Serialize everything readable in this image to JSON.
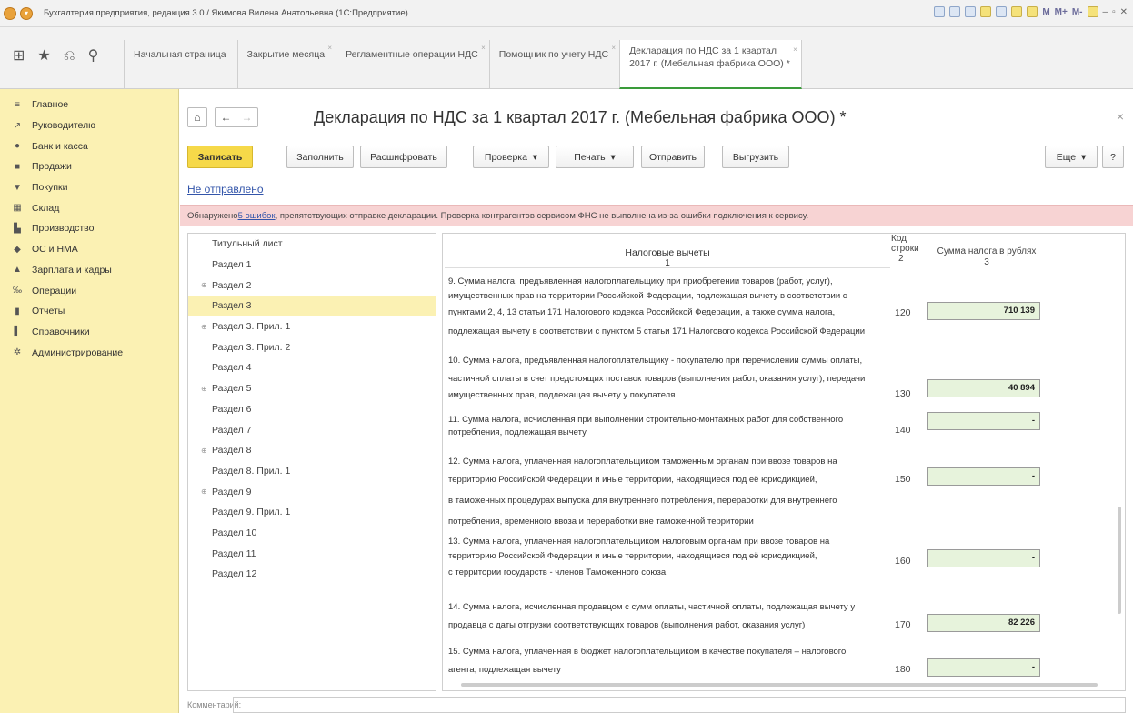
{
  "window": {
    "title": "Бухгалтерия предприятия, редакция 3.0 / Якимова Вилена Анатольевна (1С:Предприятие)",
    "controls": [
      "M",
      "M+",
      "M-"
    ]
  },
  "tabs": [
    {
      "label": "Начальная страница"
    },
    {
      "label": "Закрытие месяца"
    },
    {
      "label": "Регламентные операции НДС"
    },
    {
      "label": "Помощник по учету НДС"
    },
    {
      "label_line1": "Декларация по НДС за 1 квартал",
      "label_line2": "2017 г. (Мебельная фабрика ООО) *"
    }
  ],
  "sidebar": {
    "items": [
      {
        "label": "Главное",
        "icon": "≡"
      },
      {
        "label": "Руководителю",
        "icon": "↗"
      },
      {
        "label": "Банк и касса",
        "icon": "●"
      },
      {
        "label": "Продажи",
        "icon": "■"
      },
      {
        "label": "Покупки",
        "icon": "▼"
      },
      {
        "label": "Склад",
        "icon": "▦"
      },
      {
        "label": "Производство",
        "icon": "▙"
      },
      {
        "label": "ОС и НМА",
        "icon": "◆"
      },
      {
        "label": "Зарплата и кадры",
        "icon": "▲"
      },
      {
        "label": "Операции",
        "icon": "‰"
      },
      {
        "label": "Отчеты",
        "icon": "▮"
      },
      {
        "label": "Справочники",
        "icon": "▌"
      },
      {
        "label": "Администрирование",
        "icon": "✲"
      }
    ]
  },
  "form": {
    "title": "Декларация по НДС за 1 квартал 2017 г. (Мебельная фабрика ООО) *",
    "toolbar": {
      "save": "Записать",
      "fill": "Заполнить",
      "decode": "Расшифровать",
      "check": "Проверка",
      "print": "Печать",
      "send": "Отправить",
      "export": "Выгрузить",
      "more": "Еще",
      "help": "?"
    },
    "status": "Не отправлено",
    "error_prefix": "Обнаружено ",
    "error_link": "5 ошибок",
    "error_suffix": ", препятствующих отправке декларации. Проверка контрагентов сервисом ФНС не выполнена из-за ошибки подключения к сервису.",
    "comment_label": "Комментарий:"
  },
  "sections": [
    {
      "label": "Титульный лист",
      "expandable": false
    },
    {
      "label": "Раздел 1",
      "expandable": false
    },
    {
      "label": "Раздел 2",
      "expandable": true
    },
    {
      "label": "Раздел 3",
      "expandable": false,
      "active": true
    },
    {
      "label": "Раздел 3. Прил. 1",
      "expandable": true
    },
    {
      "label": "Раздел 3. Прил. 2",
      "expandable": false
    },
    {
      "label": "Раздел 4",
      "expandable": false
    },
    {
      "label": "Раздел 5",
      "expandable": true
    },
    {
      "label": "Раздел 6",
      "expandable": false
    },
    {
      "label": "Раздел 7",
      "expandable": false
    },
    {
      "label": "Раздел 8",
      "expandable": true
    },
    {
      "label": "Раздел 8. Прил. 1",
      "expandable": false
    },
    {
      "label": "Раздел 9",
      "expandable": true
    },
    {
      "label": "Раздел 9. Прил. 1",
      "expandable": false
    },
    {
      "label": "Раздел 10",
      "expandable": false
    },
    {
      "label": "Раздел 11",
      "expandable": false
    },
    {
      "label": "Раздел 12",
      "expandable": false
    }
  ],
  "table": {
    "header": {
      "col1_title": "Налоговые вычеты",
      "col1_num": "1",
      "code_title_1": "Код",
      "code_title_2": "строки",
      "code_num": "2",
      "sum_title": "Сумма налога в рублях",
      "sum_num": "3"
    },
    "rows": [
      {
        "lines": [
          "9. Сумма налога, предъявленная налогоплательщику при приобретении товаров (работ, услуг),",
          "имущественных прав на территории Российской Федерации, подлежащая вычету в соответствии с",
          "пунктами 2, 4, 13 статьи 171 Налогового кодекса Российской Федерации, а также сумма налога,",
          "подлежащая вычету в соответствии с пунктом 5 статьи 171 Налогового кодекса Российской Федерации"
        ],
        "code": "120",
        "value": "710 139"
      },
      {
        "lines": [
          "10. Сумма налога, предъявленная налогоплательщику - покупателю при перечислении суммы оплаты,",
          "частичной оплаты в счет предстоящих поставок товаров (выполнения работ, оказания услуг), передачи",
          "имущественных прав, подлежащая вычету у покупателя"
        ],
        "code": "130",
        "value": "40 894"
      },
      {
        "lines": [
          "11. Сумма налога, исчисленная при выполнении строительно-монтажных работ для собственного",
          "потребления, подлежащая вычету"
        ],
        "code": "140",
        "value": "-"
      },
      {
        "lines": [
          "12. Сумма налога, уплаченная налогоплательщиком таможенным органам при ввозе товаров на",
          "территорию Российской Федерации и иные территории, находящиеся под её юрисдикцией,",
          "в таможенных процедурах выпуска для внутреннего потребления, переработки для внутреннего",
          "потребления, временного ввоза и переработки вне таможенной территории"
        ],
        "code": "150",
        "value": "-"
      },
      {
        "lines": [
          "13. Сумма налога, уплаченная налогоплательщиком налоговым органам при ввозе товаров на",
          "территорию Российской Федерации и иные территории, находящиеся под её юрисдикцией,",
          "с территории государств - членов Таможенного союза"
        ],
        "code": "160",
        "value": "-"
      },
      {
        "lines": [
          "14. Сумма налога, исчисленная продавцом с сумм оплаты, частичной оплаты, подлежащая вычету у",
          "продавца с даты отгрузки соответствующих товаров (выполнения работ, оказания услуг)"
        ],
        "code": "170",
        "value": "82 226"
      },
      {
        "lines": [
          "15. Сумма налога, уплаченная в бюджет налогоплательщиком в качестве покупателя – налогового",
          "агента, подлежащая вычету"
        ],
        "code": "180",
        "value": "-"
      }
    ]
  }
}
